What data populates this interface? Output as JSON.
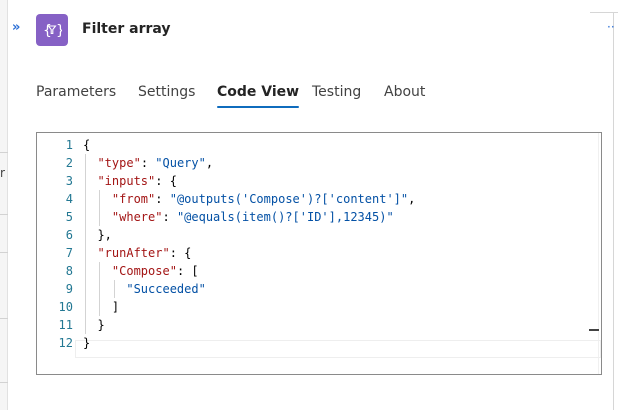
{
  "header": {
    "collapse_glyph": "»",
    "title": "Filter array",
    "more_glyph": "··",
    "icon": "filter-array-icon",
    "icon_color": "#8661c5"
  },
  "tabs": [
    {
      "label": "Parameters",
      "active": false
    },
    {
      "label": "Settings",
      "active": false
    },
    {
      "label": "Code View",
      "active": true
    },
    {
      "label": "Testing",
      "active": false
    },
    {
      "label": "About",
      "active": false
    }
  ],
  "accent_color": "#0f6cbd",
  "left_edge_glyph": "r",
  "code": {
    "line_numbers": [
      "1",
      "2",
      "3",
      "4",
      "5",
      "6",
      "7",
      "8",
      "9",
      "10",
      "11",
      "12"
    ],
    "lines": [
      [
        {
          "t": "p",
          "v": "{"
        }
      ],
      [
        {
          "t": "p",
          "v": "  "
        },
        {
          "t": "k",
          "v": "\"type\""
        },
        {
          "t": "p",
          "v": ": "
        },
        {
          "t": "s",
          "v": "\"Query\""
        },
        {
          "t": "p",
          "v": ","
        }
      ],
      [
        {
          "t": "p",
          "v": "  "
        },
        {
          "t": "k",
          "v": "\"inputs\""
        },
        {
          "t": "p",
          "v": ": {"
        }
      ],
      [
        {
          "t": "p",
          "v": "    "
        },
        {
          "t": "k",
          "v": "\"from\""
        },
        {
          "t": "p",
          "v": ": "
        },
        {
          "t": "s",
          "v": "\"@outputs('Compose')?['content']\""
        },
        {
          "t": "p",
          "v": ","
        }
      ],
      [
        {
          "t": "p",
          "v": "    "
        },
        {
          "t": "k",
          "v": "\"where\""
        },
        {
          "t": "p",
          "v": ": "
        },
        {
          "t": "s",
          "v": "\"@equals(item()?['ID'],12345)\""
        }
      ],
      [
        {
          "t": "p",
          "v": "  },"
        }
      ],
      [
        {
          "t": "p",
          "v": "  "
        },
        {
          "t": "k",
          "v": "\"runAfter\""
        },
        {
          "t": "p",
          "v": ": {"
        }
      ],
      [
        {
          "t": "p",
          "v": "    "
        },
        {
          "t": "k",
          "v": "\"Compose\""
        },
        {
          "t": "p",
          "v": ": ["
        }
      ],
      [
        {
          "t": "p",
          "v": "      "
        },
        {
          "t": "s",
          "v": "\"Succeeded\""
        }
      ],
      [
        {
          "t": "p",
          "v": "    ]"
        }
      ],
      [
        {
          "t": "p",
          "v": "  }"
        }
      ],
      [
        {
          "t": "p",
          "v": "}"
        }
      ]
    ]
  }
}
